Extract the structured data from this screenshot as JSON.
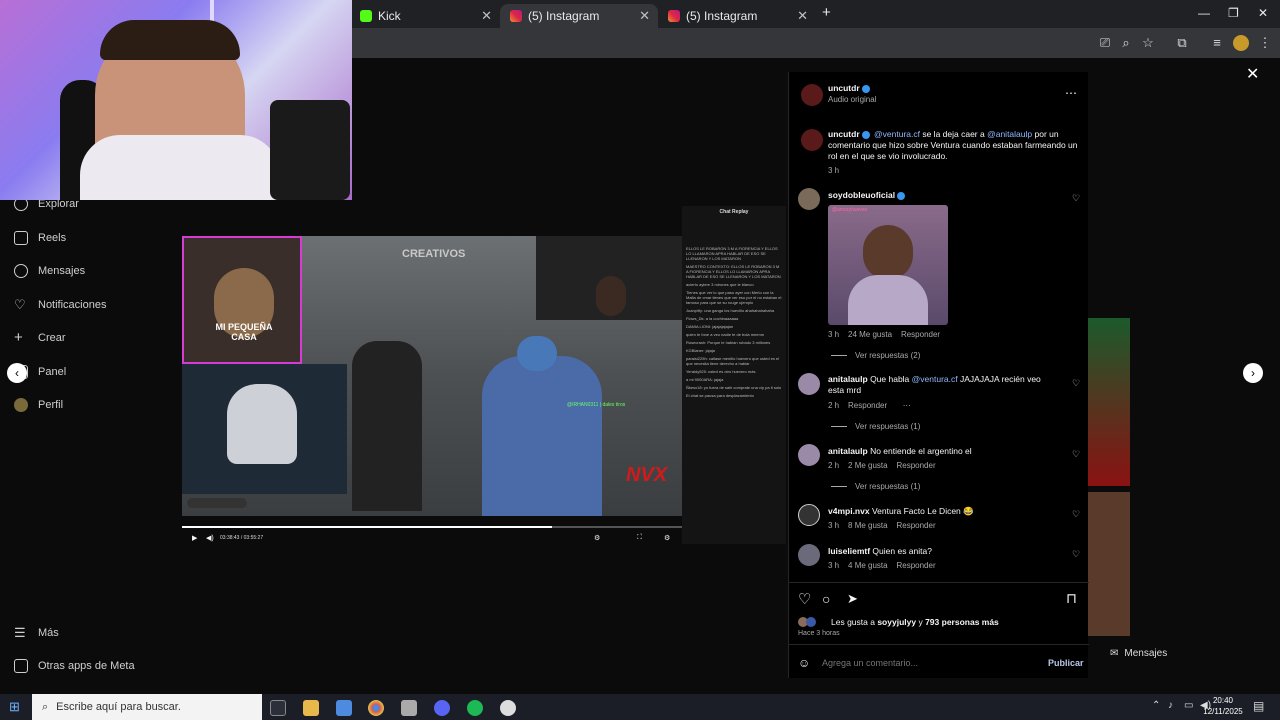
{
  "tabs": [
    {
      "label": "Kick",
      "active": false
    },
    {
      "label": "(5) Instagram",
      "active": true
    },
    {
      "label": "(5) Instagram",
      "active": false
    }
  ],
  "sidebar": {
    "items": [
      {
        "label": "Explorar",
        "icon": "compass-icon"
      },
      {
        "label": "Reels",
        "icon": "reels-icon"
      },
      {
        "label": "Mensajes",
        "icon": "messenger-icon"
      },
      {
        "label": "Notificaciones",
        "icon": "heart-icon"
      },
      {
        "label": "Crear",
        "icon": "plus-icon"
      },
      {
        "label": "Panel",
        "icon": "chart-icon"
      },
      {
        "label": "Perfil",
        "icon": "avatar-icon"
      }
    ],
    "more": "Más",
    "meta_apps": "Otras apps de Meta"
  },
  "video": {
    "watermark": "CREATIVOS",
    "overlay_title": "MI PEQUEÑA CASA",
    "logo": "NVX",
    "time": "03:38:43 / 03:55:27",
    "player_name": "@IRHAN0311 | dales tiros",
    "progress": 0.74
  },
  "chat_replay": {
    "title": "Chat Replay",
    "lines": [
      "ELLOS LE ROBARON 3 M A FIORENCIA Y ELLOS LO LLAMARON APRA HABLAR DE ESO SE LLENARON Y LOS MATARON",
      "MAESTRO CONTEXTO: ELLOS LE ROBARON 3 M A FIORENCIA Y ELLOS LO LLAMARON APRA HABLAR DE ESO SE LLENARON Y LOS MATARON",
      "acierto ayiere 3 mirones que le blanco",
      "Tienes que ver lo que paso ayer con Merlo con la Mafia de cmar tienes que ver eso por el no estaban el famoso para que se su rouge ujemplo",
      "Juanpitty: una ganga los huevillo ahahahahahaha",
      "Flows_Dk: a la cochinaaaaaa",
      "DAMIA LIONI: jajajajajajan",
      "quien te fone a veo nadie te de bola mmmm",
      "Rosecrash: Porque le habian robado 3 millones",
      "KGBlaner: jajaja",
      "paraisi225h: callase mentilo huevero que usted es el que necesita tiene derecho a hablar",
      "Yeraldy525: usted es otro huevero más",
      "a mi 9000ARA: jajaja",
      "Ñkesx18: yo fuera de salir comprate una vip pa ti solo",
      "El chat se pausa para desplazamiento"
    ]
  },
  "post": {
    "author": "uncutdr",
    "audio": "Audio original",
    "caption_user": "uncutdr",
    "caption_mention1": "@ventura.cf",
    "caption_mid": "se la deja caer a",
    "caption_mention2": "@anitalaulp",
    "caption_rest": "por un comentario que hizo sobre Ventura cuando estaban farmeando un rol en el que se vio involucrado.",
    "caption_time": "3 h",
    "likes_prefix": "Les gusta a",
    "likes_user": "soyyjulyy",
    "likes_mid": "y",
    "likes_count": "793 personas más",
    "posted": "Hace 3 horas",
    "comment_placeholder": "Agrega un comentario...",
    "publish": "Publicar"
  },
  "comments": [
    {
      "user": "soydobleuoficial",
      "verified": true,
      "text": "",
      "gif_label": "@arrozyhuevos",
      "time": "3 h",
      "likes": "24 Me gusta",
      "reply": "Responder",
      "view_replies": "Ver respuestas (2)"
    },
    {
      "user": "anitalaulp",
      "verified": false,
      "mention": "@ventura.cf",
      "pre": "Que habla",
      "text": "JAJAJAJA recién veo esta mrd",
      "time": "2 h",
      "likes": "",
      "reply": "Responder",
      "view_replies": "Ver respuestas (1)"
    },
    {
      "user": "anitalaulp",
      "verified": false,
      "text": "No entiende el argentino el",
      "time": "2 h",
      "likes": "2 Me gusta",
      "reply": "Responder",
      "view_replies": "Ver respuestas (1)"
    },
    {
      "user": "v4mpi.nvx",
      "verified": false,
      "text": "Ventura Facto Le Dicen 😂",
      "time": "3 h",
      "likes": "8 Me gusta",
      "reply": "Responder"
    },
    {
      "user": "luiseliemtf",
      "verified": false,
      "text": "Quien es anita?",
      "time": "3 h",
      "likes": "4 Me gusta",
      "reply": "Responder"
    }
  ],
  "messages_float": "Mensajes",
  "taskbar": {
    "search_placeholder": "Escribe aquí para buscar.",
    "time": "20:40",
    "date": "12/11/2025"
  },
  "colors": {
    "ig_blue": "#3897f0",
    "taskbar": "#1b1e27"
  }
}
